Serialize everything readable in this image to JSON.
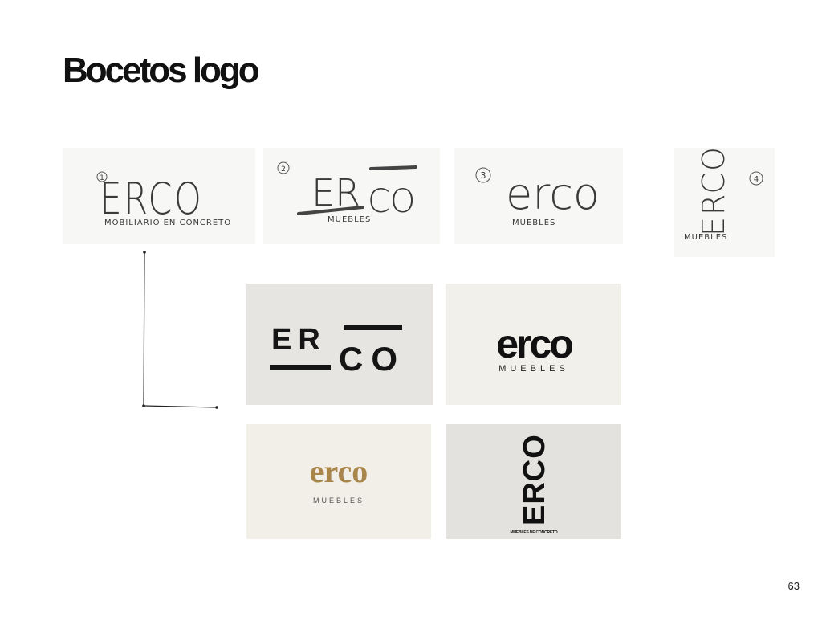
{
  "slide": {
    "title": "Bocetos logo",
    "page_number": "63"
  },
  "sketches": [
    {
      "number": "1",
      "wordmark": "ERCO",
      "tagline": "MOBILIARIO EN CONCRETO"
    },
    {
      "number": "2",
      "wordmark_left": "ER",
      "wordmark_right": "CO",
      "tagline": "MUEBLES"
    },
    {
      "number": "3",
      "wordmark": "erco",
      "tagline": "MUEBLES"
    },
    {
      "number": "4",
      "wordmark": "ERCO",
      "tagline": "MUEBLES"
    }
  ],
  "mockups": [
    {
      "wordmark_top": "ER",
      "wordmark_bottom": "CO",
      "background": "#e6e5e1"
    },
    {
      "wordmark": "erco",
      "tagline": "MUEBLES",
      "background": "#f2f0ea"
    },
    {
      "wordmark": "erco",
      "tagline": "MUEBLES",
      "background": "#f1efe8",
      "accent": "#a8854a"
    },
    {
      "wordmark": "ERCO",
      "tagline": "MUEBLES DE CONCRETO",
      "background": "#e3e2de"
    }
  ]
}
